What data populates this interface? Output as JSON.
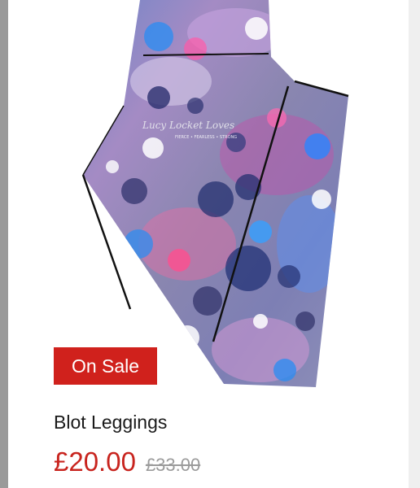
{
  "product": {
    "image_alt": "Blot Leggings",
    "image_brand_text": "Lucy Locket Loves",
    "image_tagline": "FIERCE • FEARLESS • STRONG",
    "badge": "On Sale",
    "title": "Blot Leggings",
    "price": "£20.00",
    "original_price": "£33.00"
  },
  "colors": {
    "sale_red": "#d0211c",
    "price_red": "#c8241e",
    "strike_grey": "#9b9b9b"
  }
}
